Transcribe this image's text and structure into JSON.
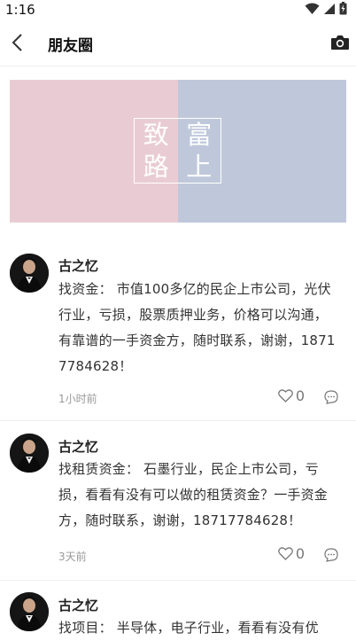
{
  "status": {
    "time": "1:16"
  },
  "nav": {
    "title": "朋友圈"
  },
  "banner": {
    "chars": [
      "致",
      "富",
      "路",
      "上"
    ]
  },
  "posts": [
    {
      "author": "古之忆",
      "content": "找资金： 市值100多亿的民企上市公司，光伏行业，亏损，股票质押业务，价格可以沟通，有靠谱的一手资金方，随时联系，谢谢，18717784628！",
      "time": "1小时前",
      "likes": "0"
    },
    {
      "author": "古之忆",
      "content": "找租赁资金： 石墨行业，民企上市公司，亏损，看看有没有可以做的租赁资金？一手资金方，随时联系，谢谢，18717784628！",
      "time": "3天前",
      "likes": "0"
    },
    {
      "author": "古之忆",
      "content": "找项目： 半导体，电子行业，看看有没有优",
      "time": "",
      "likes": ""
    }
  ],
  "icons": {
    "back": "back-arrow-icon",
    "camera": "camera-icon",
    "like": "heart-icon",
    "comment": "comment-icon"
  }
}
